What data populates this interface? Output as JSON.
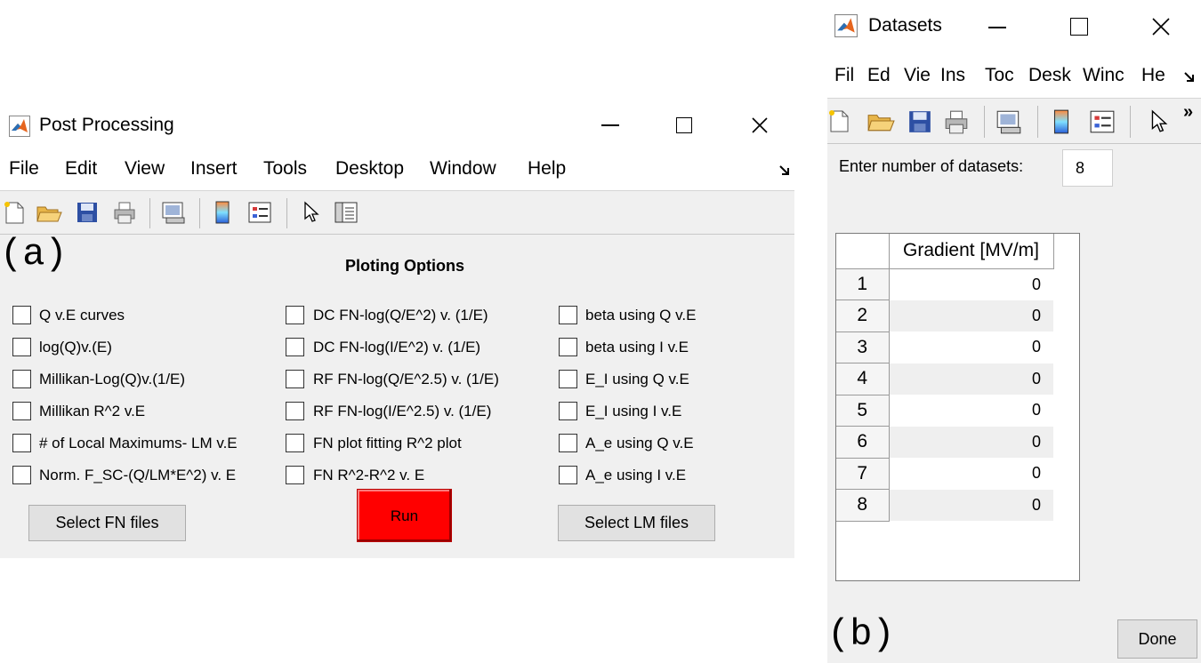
{
  "post_processing": {
    "title": "Post Processing",
    "menu": [
      "File",
      "Edit",
      "View",
      "Insert",
      "Tools",
      "Desktop",
      "Window",
      "Help"
    ],
    "panel_label": "(a)",
    "section_title": "Ploting Options",
    "col1": [
      "Q v.E curves",
      "log(Q)v.(E)",
      "Millikan-Log(Q)v.(1/E)",
      "Millikan R^2 v.E",
      "# of Local Maximums- LM v.E",
      "Norm. F_SC-(Q/LM*E^2) v. E"
    ],
    "col2": [
      "DC FN-log(Q/E^2) v. (1/E)",
      "DC FN-log(I/E^2) v. (1/E)",
      "RF FN-log(Q/E^2.5) v. (1/E)",
      "RF FN-log(I/E^2.5) v. (1/E)",
      "FN plot fitting R^2 plot",
      "FN R^2-R^2 v. E"
    ],
    "col3": [
      "beta using Q v.E",
      "beta using I v.E",
      "E_I using Q v.E",
      "E_I using I v.E",
      "A_e using Q v.E",
      "A_e using I v.E"
    ],
    "btn_fn": "Select FN files",
    "btn_run": "Run",
    "btn_lm": "Select LM files"
  },
  "datasets": {
    "title": "Datasets",
    "menu": [
      "Fil",
      "Ed",
      "Vie",
      "Ins",
      "Toc",
      "Desk",
      "Winc",
      "He"
    ],
    "prompt": "Enter number of datasets:",
    "count": "8",
    "column_header": "Gradient [MV/m]",
    "row_numbers": [
      "1",
      "2",
      "3",
      "4",
      "5",
      "6",
      "7",
      "8"
    ],
    "values": [
      "0",
      "0",
      "0",
      "0",
      "0",
      "0",
      "0",
      "0"
    ],
    "panel_label": "(b)",
    "done": "Done"
  },
  "colors": {
    "run_button": "#ff0000",
    "window_bg": "#f0f0f0",
    "matlab_icon": "#e6651e"
  }
}
